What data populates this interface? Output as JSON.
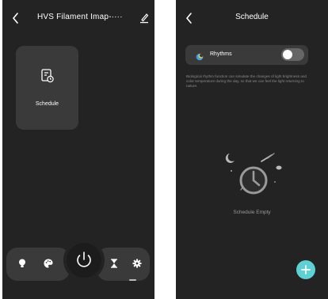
{
  "left_screen": {
    "title": "HVS Filament Imap-····",
    "card": {
      "label": "Schedule"
    },
    "dock": {
      "left_icons": [
        "bulb-icon",
        "palette-icon"
      ],
      "center_icon": "power-icon",
      "right_icons": [
        "hourglass-icon",
        "gear-icon"
      ]
    }
  },
  "right_screen": {
    "title": "Schedule",
    "rhythms": {
      "label": "Rhythms",
      "enabled": false
    },
    "description": "Biological rhythm function can simulate the changes of light brightness and color temperature during the day, so that we can feel the light returning to nature.",
    "empty_text": "Schedule Empty",
    "fab_icon": "plus-icon"
  },
  "colors": {
    "background": "#232323",
    "card": "#3a3a3a",
    "accent": "#5fd0d4",
    "toggle_off": "#666666"
  }
}
